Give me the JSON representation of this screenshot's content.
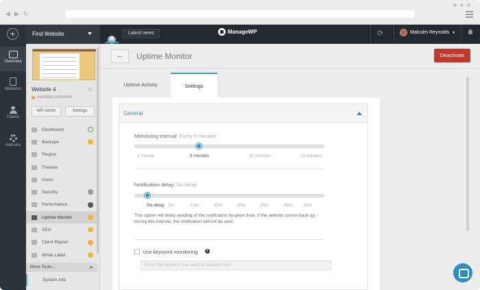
{
  "topbar": {
    "site_select": "Find Website",
    "latest_news": "Latest news",
    "brand": "ManageWP",
    "user_name": "Malcolm Reynolds"
  },
  "icon_nav": [
    {
      "label": "Overview",
      "icon": "monitor-icon"
    },
    {
      "label": "Websites",
      "icon": "document-icon"
    },
    {
      "label": "Clients",
      "icon": "people-icon"
    },
    {
      "label": "Add-ons",
      "icon": "gear-icon"
    }
  ],
  "site": {
    "name": "Website 4",
    "url": "example.com/store",
    "wp_admin": "WP Admin",
    "settings": "Settings"
  },
  "menu": [
    {
      "label": "Dashboard",
      "icon": "dashboard-icon",
      "badge": "ok"
    },
    {
      "label": "Backups",
      "icon": "backups-icon",
      "badge": "warn"
    },
    {
      "label": "Plugins",
      "icon": "plugins-icon",
      "badge": ""
    },
    {
      "label": "Themes",
      "icon": "themes-icon",
      "badge": ""
    },
    {
      "label": "Users",
      "icon": "users-icon",
      "badge": ""
    },
    {
      "label": "Security",
      "icon": "security-icon",
      "badge": "grey"
    },
    {
      "label": "Performance",
      "icon": "performance-icon",
      "badge": "dark"
    },
    {
      "label": "Uptime Monitor",
      "icon": "uptime-icon",
      "badge": "warn",
      "active": true
    },
    {
      "label": "SEO",
      "icon": "seo-icon",
      "badge": "warn"
    },
    {
      "label": "Client Report",
      "icon": "report-icon",
      "badge": "warn"
    },
    {
      "label": "White Label",
      "icon": "label-icon",
      "badge": "warn"
    }
  ],
  "more_tools": "More Tools...",
  "system_info": "System Info",
  "page": {
    "title": "Uptime Monitor",
    "deactivate": "Deactivate",
    "tabs": [
      "Uptime Activity",
      "Settings"
    ],
    "active_tab": 1
  },
  "general": {
    "heading": "General",
    "monitoring_label": "Monitoring interval:",
    "monitoring_value": "Every 5 minutes",
    "monitoring_ticks": [
      "1 minute",
      "5 minutes",
      "10 minutes",
      "15 minutes"
    ],
    "monitoring_selected_index": 1,
    "notification_label": "Notification delay:",
    "notification_value": "No delay",
    "notification_ticks": [
      "No delay",
      "5m",
      "10m",
      "15m",
      "20m",
      "30m",
      "45m",
      "60m"
    ],
    "notification_selected_index": 0,
    "notification_note": "This option will delay sending of the notification by given time. If the website comes back up during this interval, the notification will not be sent.",
    "keyword_label": "Use keyword monitoring",
    "keyword_placeholder": "Enter the keyword you want to monitor here"
  },
  "colors": {
    "accent": "#3a8fbc",
    "danger": "#c0392b",
    "dark_bar": "#23292e",
    "warning": "#f0b43c",
    "success": "#4ab03b"
  }
}
